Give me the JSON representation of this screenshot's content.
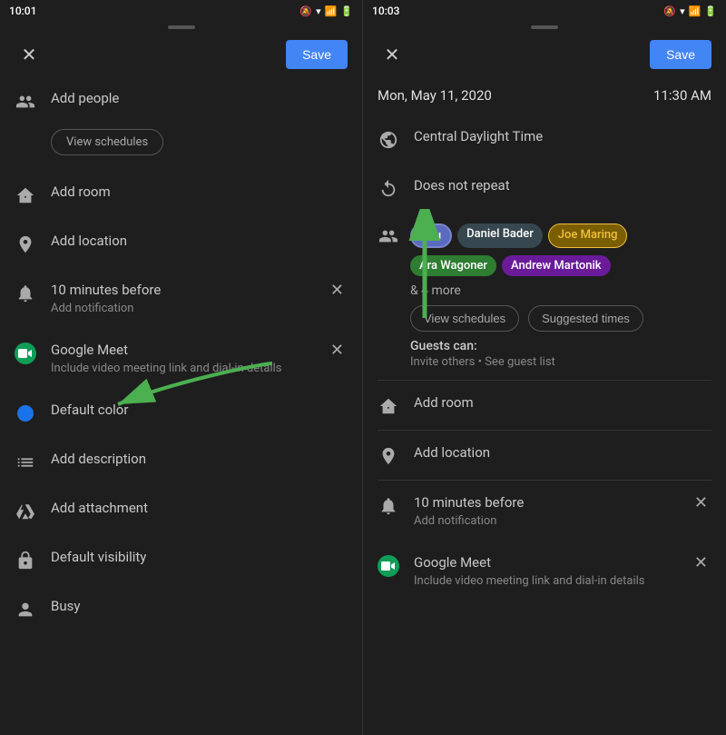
{
  "left": {
    "status_time": "10:01",
    "close_label": "✕",
    "save_label": "Save",
    "items": [
      {
        "id": "add-people",
        "icon": "👤",
        "icon_type": "person-group",
        "label": "Add people",
        "subtext": ""
      },
      {
        "id": "view-schedules",
        "label": "View schedules"
      },
      {
        "id": "add-room",
        "icon": "🏢",
        "icon_type": "building",
        "label": "Add room",
        "subtext": ""
      },
      {
        "id": "add-location",
        "icon": "📍",
        "icon_type": "location",
        "label": "Add location",
        "subtext": ""
      },
      {
        "id": "notification",
        "icon": "🔔",
        "icon_type": "bell",
        "label": "10 minutes before",
        "subtext": "Add notification",
        "has_close": true
      },
      {
        "id": "google-meet",
        "icon": "meet",
        "icon_type": "meet",
        "label": "Google Meet",
        "subtext": "Include video meeting link and dial-in details",
        "has_close": true
      },
      {
        "id": "default-color",
        "icon": "circle",
        "icon_type": "circle-blue",
        "label": "Default color",
        "subtext": ""
      },
      {
        "id": "add-description",
        "icon": "☰",
        "icon_type": "lines",
        "label": "Add description",
        "subtext": ""
      },
      {
        "id": "add-attachment",
        "icon": "📎",
        "icon_type": "drive",
        "label": "Add attachment",
        "subtext": ""
      },
      {
        "id": "default-visibility",
        "icon": "🔒",
        "icon_type": "lock",
        "label": "Default visibility",
        "subtext": ""
      },
      {
        "id": "busy",
        "icon": "👤",
        "icon_type": "person",
        "label": "Busy",
        "subtext": ""
      }
    ]
  },
  "right": {
    "status_time": "10:03",
    "close_label": "✕",
    "save_label": "Save",
    "date": "Mon, May 11, 2020",
    "time": "11:30 AM",
    "timezone": "Central Daylight Time",
    "repeat": "Does not repeat",
    "guests": {
      "chips": [
        {
          "id": "you",
          "label": "You",
          "style": "you"
        },
        {
          "id": "daniel",
          "label": "Daniel Bader",
          "style": "daniel"
        },
        {
          "id": "joe",
          "label": "Joe Maring",
          "style": "joe"
        },
        {
          "id": "ara",
          "label": "Ara Wagoner",
          "style": "ara"
        },
        {
          "id": "andrew",
          "label": "Andrew Martonik",
          "style": "andrew"
        }
      ],
      "more": "& 4 more",
      "view_schedules_label": "View schedules",
      "suggested_times_label": "Suggested times",
      "guests_can_label": "Guests can:",
      "guests_can_detail": "Invite others • See guest list"
    },
    "items": [
      {
        "id": "add-room",
        "icon": "🏢",
        "label": "Add room",
        "subtext": ""
      },
      {
        "id": "add-location",
        "icon": "📍",
        "label": "Add location",
        "subtext": ""
      },
      {
        "id": "notification",
        "icon": "🔔",
        "label": "10 minutes before",
        "subtext": "Add notification",
        "has_close": true
      },
      {
        "id": "google-meet",
        "icon": "meet",
        "label": "Google Meet",
        "subtext": "Include video meeting link and dial-in details",
        "has_close": true
      }
    ]
  },
  "arrow_left": {
    "color": "#4caf50"
  },
  "arrow_right": {
    "color": "#4caf50"
  }
}
